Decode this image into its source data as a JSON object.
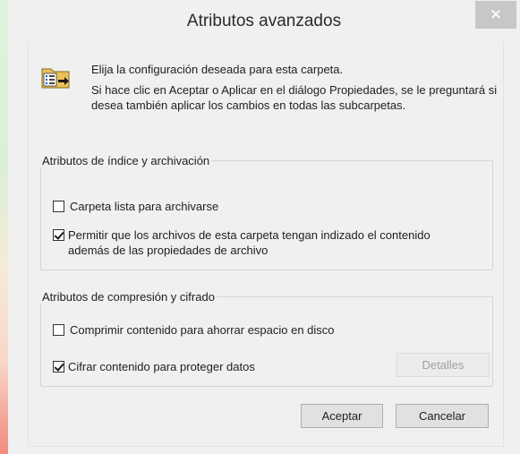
{
  "window": {
    "title": "Atributos avanzados",
    "close_glyph": "✕"
  },
  "intro": {
    "line1": "Elija la configuración deseada para esta carpeta.",
    "line2": "Si hace clic en Aceptar o Aplicar en el diálogo Propiedades, se le preguntará si desea también aplicar los cambios en todas las subcarpetas.",
    "icon": "folder-properties-icon"
  },
  "index_group": {
    "legend": "Atributos de índice y archivación",
    "archive_label": "Carpeta lista para archivarse",
    "archive_checked": false,
    "indexed_label": "Permitir que los archivos de esta carpeta tengan indizado el contenido además de las propiedades de archivo",
    "indexed_checked": true
  },
  "compress_group": {
    "legend": "Atributos de compresión y cifrado",
    "compress_label": "Comprimir contenido para ahorrar espacio en disco",
    "compress_checked": false,
    "encrypt_label": "Cifrar contenido para proteger datos",
    "encrypt_checked": true,
    "details_label": "Detalles"
  },
  "buttons": {
    "ok_label": "Aceptar",
    "cancel_label": "Cancelar"
  },
  "colors": {
    "dialog_bg": "#f0f0f0",
    "close_button_bg": "#c7c7c7",
    "button_border": "#adadad"
  }
}
